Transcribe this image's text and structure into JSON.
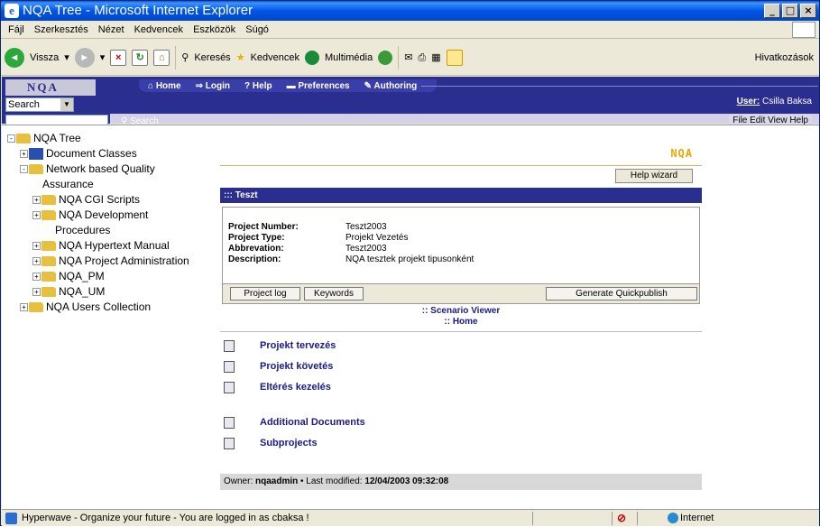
{
  "window": {
    "title": "NQA Tree - Microsoft Internet Explorer"
  },
  "menu": [
    "Fájl",
    "Szerkesztés",
    "Nézet",
    "Kedvencek",
    "Eszközök",
    "Súgó"
  ],
  "toolbar": {
    "back": "Vissza",
    "search": "Keresés",
    "favorites": "Kedvencek",
    "media": "Multimédia",
    "links": "Hivatkozások"
  },
  "app": {
    "logo": "NQA",
    "search_select": "Search",
    "search_label": "Search",
    "nav": [
      "Home",
      "Login",
      "Help",
      "Preferences",
      "Authoring"
    ],
    "user_label": "User:",
    "user_name": "Csilla Baksa",
    "file_menu": "File Edit View Help"
  },
  "tree": [
    {
      "label": "NQA Tree",
      "level": 0,
      "toggle": "-",
      "icon": "folder"
    },
    {
      "label": "Document Classes",
      "level": 1,
      "toggle": "+",
      "icon": "doc"
    },
    {
      "label": "Network based Quality",
      "level": 1,
      "toggle": "-",
      "icon": "folder"
    },
    {
      "label": "Assurance",
      "level": 1,
      "toggle": "",
      "icon": "none"
    },
    {
      "label": "NQA CGI Scripts",
      "level": 2,
      "toggle": "+",
      "icon": "folder"
    },
    {
      "label": "NQA Development",
      "level": 2,
      "toggle": "+",
      "icon": "folder"
    },
    {
      "label": "Procedures",
      "level": 2,
      "toggle": "",
      "icon": "none"
    },
    {
      "label": "NQA Hypertext Manual",
      "level": 2,
      "toggle": "+",
      "icon": "folder"
    },
    {
      "label": "NQA Project Administration",
      "level": 2,
      "toggle": "+",
      "icon": "folder"
    },
    {
      "label": "NQA_PM",
      "level": 2,
      "toggle": "+",
      "icon": "folder"
    },
    {
      "label": "NQA_UM",
      "level": 2,
      "toggle": "+",
      "icon": "folder"
    },
    {
      "label": "NQA Users Collection",
      "level": 1,
      "toggle": "+",
      "icon": "folder"
    }
  ],
  "main": {
    "brand": "NQA",
    "help_wizard": "Help wizard",
    "section_title": "::: Teszt",
    "info": [
      {
        "k": "Project Number:",
        "v": "Teszt2003"
      },
      {
        "k": "Project Type:",
        "v": "Projekt Vezetés"
      },
      {
        "k": "Abbrevation:",
        "v": "Teszt2003"
      },
      {
        "k": "Description:",
        "v": "NQA tesztek projekt tipusonként"
      }
    ],
    "buttons": {
      "log": "Project log",
      "keywords": "Keywords",
      "quickpublish": "Generate Quickpublish"
    },
    "scenario": ":: Scenario Viewer",
    "home": ":: Home",
    "links": [
      "Projekt tervezés",
      "Projekt követés",
      "Eltérés kezelés",
      "Additional Documents",
      "Subprojects"
    ],
    "owner_label": "Owner:",
    "owner": "nqaadmin",
    "modified_label": "• Last modified:",
    "modified": "12/04/2003 09:32:08"
  },
  "status": {
    "message": "Hyperwave - Organize your future - You are logged in as cbaksa !",
    "zone": "Internet"
  }
}
